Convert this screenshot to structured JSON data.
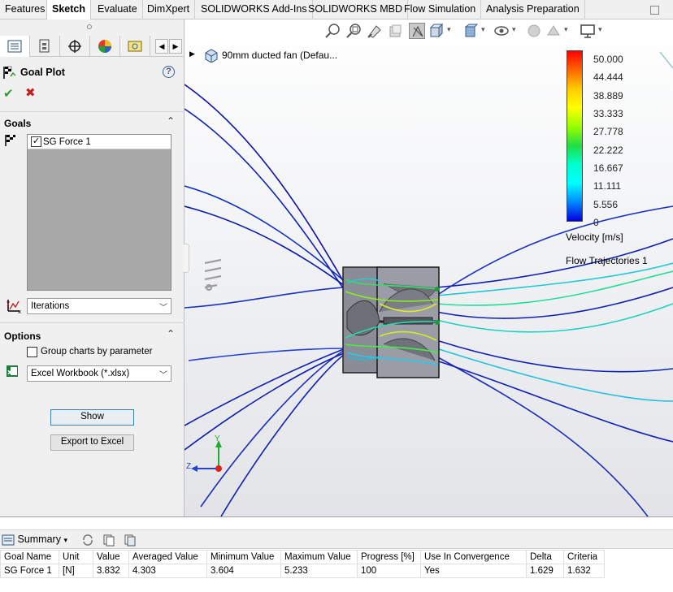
{
  "tabs": [
    "Features",
    "Sketch",
    "Evaluate",
    "DimXpert",
    "SOLIDWORKS Add-Ins",
    "SOLIDWORKS MBD",
    "Flow Simulation",
    "Analysis Preparation"
  ],
  "active_tab": "Sketch",
  "property_manager": {
    "title": "Goal Plot",
    "goals_section": {
      "title": "Goals",
      "items": [
        {
          "label": "SG Force 1",
          "checked": true
        }
      ]
    },
    "x_axis_select": "Iterations",
    "options_section": {
      "title": "Options",
      "group_charts_label": "Group charts by parameter",
      "group_charts_checked": false,
      "export_format": "Excel Workbook (*.xlsx)"
    },
    "show_button": "Show",
    "export_button": "Export to Excel"
  },
  "viewport": {
    "tree_item": "90mm ducted fan  (Defau...",
    "legend": {
      "ticks": [
        "50.000",
        "44.444",
        "38.889",
        "33.333",
        "27.778",
        "22.222",
        "16.667",
        "11.111",
        "5.556",
        "0"
      ],
      "colors": [
        "#ff0000",
        "#ff6600",
        "#ffcc00",
        "#ffff00",
        "#99ff00",
        "#22dd44",
        "#00ffcc",
        "#00ffff",
        "#0088ff",
        "#0000dd"
      ],
      "title": "Velocity [m/s]",
      "trajectories_label": "Flow Trajectories 1"
    },
    "triad": {
      "y": "Y",
      "z": "Z"
    }
  },
  "summary": {
    "tab_label": "Summary",
    "columns": [
      "Goal Name",
      "Unit",
      "Value",
      "Averaged Value",
      "Minimum Value",
      "Maximum Value",
      "Progress [%]",
      "Use In Convergence",
      "Delta",
      "Criteria"
    ],
    "rows": [
      [
        "SG Force 1",
        "[N]",
        "3.832",
        "4.303",
        "3.604",
        "5.233",
        "100",
        "Yes",
        "1.629",
        "1.632"
      ]
    ]
  }
}
